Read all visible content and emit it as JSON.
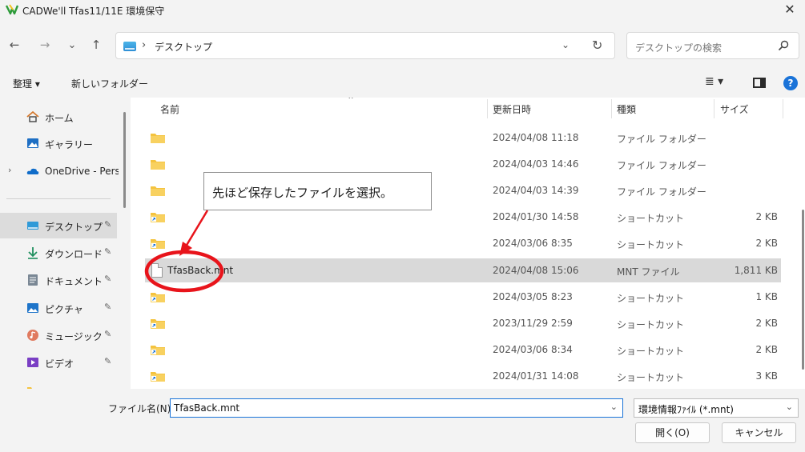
{
  "window": {
    "title": "CADWe'll Tfas11/11E 環境保守",
    "close_glyph": "✕"
  },
  "nav": {
    "back": "←",
    "forward": "→",
    "recent": "⌄",
    "up": "↑",
    "address_sep": "›",
    "address": "デスクトップ",
    "address_chevron": "⌄",
    "refresh": "↻",
    "search_placeholder": "デスクトップの検索"
  },
  "toolbar": {
    "organize": "整理 ▾",
    "new_folder": "新しいフォルダー",
    "view": "≣ ▾",
    "help": "?"
  },
  "sidebar": {
    "items": [
      {
        "label": "ホーム",
        "icon": "home-icon",
        "pinned": false
      },
      {
        "label": "ギャラリー",
        "icon": "gallery-icon",
        "pinned": false
      },
      {
        "label": "OneDrive - Perso",
        "icon": "onedrive-icon",
        "pinned": false,
        "expander": "›"
      },
      {
        "label": "デスクトップ",
        "icon": "desktop-icon",
        "pinned": true,
        "selected": true
      },
      {
        "label": "ダウンロード",
        "icon": "download-icon",
        "pinned": true
      },
      {
        "label": "ドキュメント",
        "icon": "documents-icon",
        "pinned": true
      },
      {
        "label": "ピクチャ",
        "icon": "pictures-icon",
        "pinned": true
      },
      {
        "label": "ミュージック",
        "icon": "music-icon",
        "pinned": true
      },
      {
        "label": "ビデオ",
        "icon": "videos-icon",
        "pinned": true
      }
    ],
    "pin_glyph": "📌"
  },
  "columns": {
    "name": "名前",
    "date": "更新日時",
    "type": "種類",
    "size": "サイズ",
    "sort_arrow": "⌃"
  },
  "files": [
    {
      "name": "",
      "date": "2024/04/08 11:18",
      "type": "ファイル フォルダー",
      "size": "",
      "kind": "folder"
    },
    {
      "name": "",
      "date": "2024/04/03 14:46",
      "type": "ファイル フォルダー",
      "size": "",
      "kind": "folder"
    },
    {
      "name": "",
      "date": "2024/04/03 14:39",
      "type": "ファイル フォルダー",
      "size": "",
      "kind": "folder"
    },
    {
      "name": "",
      "date": "2024/01/30 14:58",
      "type": "ショートカット",
      "size": "2 KB",
      "kind": "shortcut"
    },
    {
      "name": "",
      "date": "2024/03/06 8:35",
      "type": "ショートカット",
      "size": "2 KB",
      "kind": "shortcut"
    },
    {
      "name": "TfasBack.mnt",
      "date": "2024/04/08 15:06",
      "type": "MNT ファイル",
      "size": "1,811 KB",
      "kind": "file",
      "selected": true
    },
    {
      "name": "",
      "date": "2024/03/05 8:23",
      "type": "ショートカット",
      "size": "1 KB",
      "kind": "shortcut"
    },
    {
      "name": "",
      "date": "2023/11/29 2:59",
      "type": "ショートカット",
      "size": "2 KB",
      "kind": "shortcut"
    },
    {
      "name": "",
      "date": "2024/03/06 8:34",
      "type": "ショートカット",
      "size": "2 KB",
      "kind": "shortcut"
    },
    {
      "name": "",
      "date": "2024/01/31 14:08",
      "type": "ショートカット",
      "size": "3 KB",
      "kind": "shortcut"
    }
  ],
  "callout": {
    "text": "先ほど保存したファイルを選択。",
    "highlight_color": "#e8141b"
  },
  "footer": {
    "filename_label": "ファイル名(N):",
    "filename_value": "TfasBack.mnt",
    "filter_value": "環境情報ﾌｧｲﾙ (*.mnt)",
    "chevron": "⌄",
    "open_button": "開く(O)",
    "cancel_button": "キャンセル"
  },
  "colors": {
    "accent": "#1a73d8",
    "folder": "#f4c33f",
    "selection": "#d9d9d9"
  }
}
